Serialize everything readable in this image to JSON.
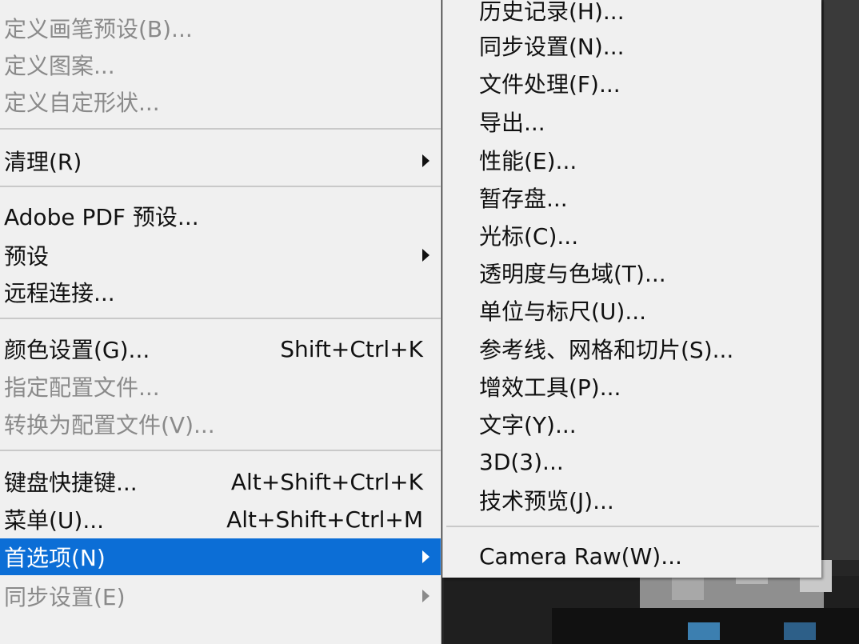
{
  "left_menu": {
    "items": [
      {
        "label": "定义画笔预设(B)..."
      },
      {
        "label": "定义图案..."
      },
      {
        "label": "定义自定形状..."
      },
      {
        "label": "清理(R)"
      },
      {
        "label": "Adobe PDF 预设..."
      },
      {
        "label": "预设"
      },
      {
        "label": "远程连接..."
      },
      {
        "label": "颜色设置(G)...",
        "shortcut": "Shift+Ctrl+K"
      },
      {
        "label": "指定配置文件..."
      },
      {
        "label": "转换为配置文件(V)..."
      },
      {
        "label": "键盘快捷键...",
        "shortcut": "Alt+Shift+Ctrl+K"
      },
      {
        "label": "菜单(U)...",
        "shortcut": "Alt+Shift+Ctrl+M"
      },
      {
        "label": "首选项(N)"
      },
      {
        "label": "同步设置(E)"
      }
    ]
  },
  "submenu": {
    "items": [
      {
        "label": "历史记录(H)..."
      },
      {
        "label": "同步设置(N)..."
      },
      {
        "label": "文件处理(F)..."
      },
      {
        "label": "导出..."
      },
      {
        "label": "性能(E)..."
      },
      {
        "label": "暂存盘..."
      },
      {
        "label": "光标(C)..."
      },
      {
        "label": "透明度与色域(T)..."
      },
      {
        "label": "单位与标尺(U)..."
      },
      {
        "label": "参考线、网格和切片(S)..."
      },
      {
        "label": "增效工具(P)..."
      },
      {
        "label": "文字(Y)..."
      },
      {
        "label": "3D(3)..."
      },
      {
        "label": "技术预览(J)..."
      },
      {
        "label": "Camera Raw(W)..."
      }
    ]
  },
  "colors": {
    "menu_bg": "#f0f0f0",
    "selection": "#0c6ed6",
    "disabled_text": "#8a8a8a"
  }
}
